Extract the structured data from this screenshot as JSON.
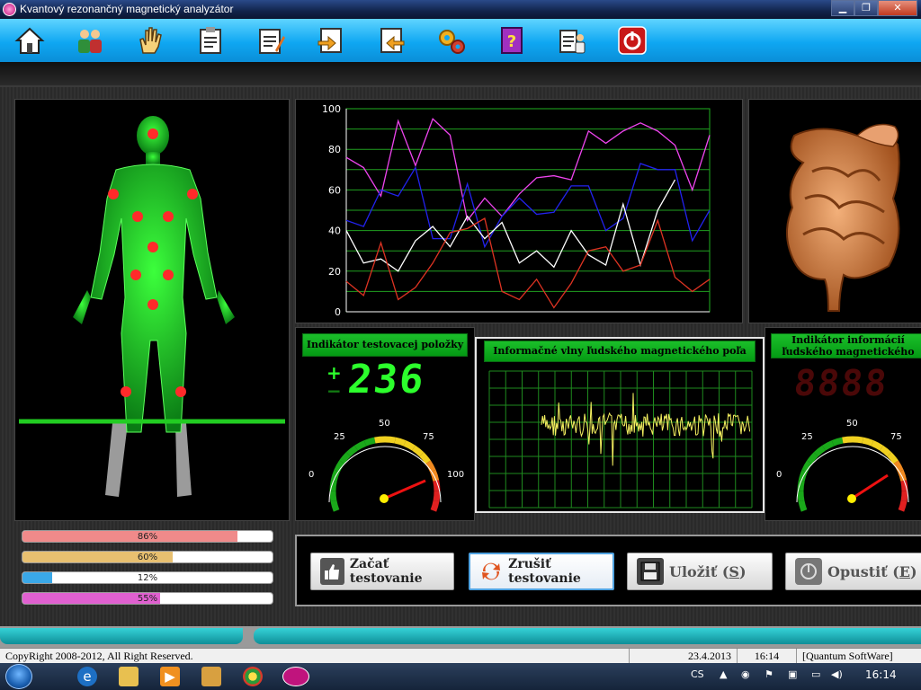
{
  "window": {
    "title": "Kvantový rezonančný magnetický analyzátor",
    "min": "▁",
    "max": "❐",
    "close": "✕"
  },
  "toolbar": {
    "items": [
      "home-icon",
      "users-icon",
      "hand-icon",
      "clipboard-icon",
      "report-icon",
      "import-icon",
      "export-icon",
      "gears-icon",
      "help-book-icon",
      "doctor-icon",
      "power-icon"
    ]
  },
  "chart_data": {
    "type": "line",
    "x": [
      0,
      1,
      2,
      3,
      4,
      5,
      6,
      7,
      8,
      9,
      10,
      11,
      12,
      13,
      14,
      15,
      16,
      17,
      18,
      19,
      20,
      21,
      22,
      23,
      24,
      25,
      26,
      27,
      28,
      29
    ],
    "ylim": [
      0,
      100
    ],
    "yticks": [
      "0",
      "20",
      "40",
      "60",
      "80",
      "100"
    ],
    "series": [
      {
        "color": "#ee44ee",
        "values": [
          76,
          71,
          57,
          94,
          72,
          95,
          87,
          45,
          56,
          47,
          58,
          66,
          67,
          65,
          89,
          83,
          89,
          93,
          89,
          82,
          60,
          87,
          null,
          null,
          null,
          null,
          null,
          null,
          null,
          null
        ]
      },
      {
        "color": "#2222ee",
        "values": [
          45,
          42,
          60,
          57,
          71,
          36,
          36,
          63,
          32,
          47,
          56,
          48,
          49,
          62,
          62,
          40,
          46,
          73,
          70,
          70,
          35,
          50,
          null,
          null,
          null,
          null,
          null,
          null,
          null,
          null
        ]
      },
      {
        "color": "#ffffff",
        "values": [
          40,
          24,
          26,
          20,
          35,
          42,
          32,
          47,
          36,
          44,
          24,
          30,
          22,
          40,
          28,
          23,
          53,
          23,
          50,
          65,
          null,
          null,
          null,
          null,
          null,
          null,
          null,
          null,
          null,
          null
        ]
      },
      {
        "color": "#dd3322",
        "values": [
          15,
          8,
          34,
          6,
          12,
          24,
          39,
          41,
          46,
          10,
          6,
          16,
          2,
          14,
          30,
          32,
          20,
          23,
          45,
          17,
          10,
          16,
          null,
          null,
          null,
          null,
          null,
          null,
          null,
          null
        ]
      }
    ]
  },
  "indicator1": {
    "title": "Indikátor testovacej položky",
    "plus": "+",
    "minus": "−",
    "digits": "236",
    "gauge": {
      "t0": "0",
      "t25": "25",
      "t50": "50",
      "t75": "75",
      "t100": "100"
    }
  },
  "wave": {
    "title": "Informačné vlny ľudského magnetického poľa"
  },
  "indicator2": {
    "title": "Indikátor informácií ľudského magnetického poľa",
    "digits": "8888",
    "gauge": {
      "t0": "0",
      "t25": "25",
      "t50": "50",
      "t75": "75"
    }
  },
  "progress": [
    {
      "label": "86%",
      "value": 86,
      "color": "#f08a8a"
    },
    {
      "label": "60%",
      "value": 60,
      "color": "#e8c070"
    },
    {
      "label": "12%",
      "value": 12,
      "color": "#3aa8e8"
    },
    {
      "label": "55%",
      "value": 55,
      "color": "#e060d0"
    }
  ],
  "actions": {
    "start": "Začať testovanie",
    "cancel": "Zrušiť testovanie",
    "save_prefix": "Uložiť (",
    "save_key": "S",
    "save_suffix": ")",
    "exit_prefix": "Opustiť (",
    "exit_key": "E",
    "exit_suffix": ")"
  },
  "status": {
    "copyright": "CopyRight 2008-2012, All Right Reserved.",
    "date": "23.4.2013",
    "time": "16:14",
    "vendor": "[Quantum SoftWare]"
  },
  "taskbar": {
    "lang": "CS",
    "clock": "16:14"
  }
}
